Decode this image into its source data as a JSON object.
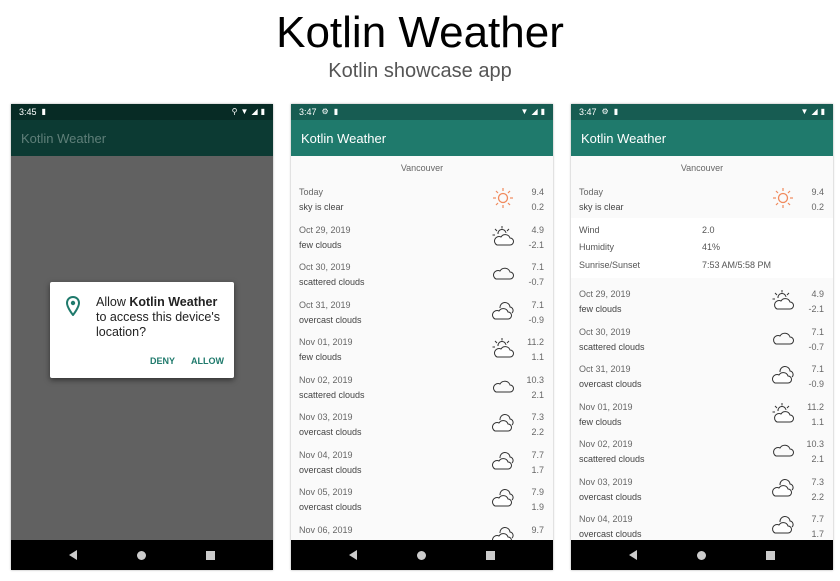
{
  "header": {
    "title": "Kotlin Weather",
    "subtitle": "Kotlin showcase app"
  },
  "colors": {
    "primary": "#1f7a6c",
    "primary_dark": "#175c52",
    "dim_status": "#072b25",
    "dim_appbar": "#0c3a33",
    "dim_body": "#616161"
  },
  "screens": [
    {
      "status_time": "3:45",
      "app_title": "Kotlin Weather",
      "dialog": {
        "text_prefix": "Allow ",
        "app_name": "Kotlin Weather",
        "text_suffix": " to access this device's location?",
        "deny": "DENY",
        "allow": "ALLOW"
      }
    },
    {
      "status_time": "3:47",
      "app_title": "Kotlin Weather",
      "city": "Vancouver",
      "rows": [
        {
          "date": "Today",
          "desc": "sky is clear",
          "max": "9.4",
          "min": "0.2",
          "icon": "sun-icon"
        },
        {
          "date": "Oct 29, 2019",
          "desc": "few clouds",
          "max": "4.9",
          "min": "-2.1",
          "icon": "sun-cloud-icon"
        },
        {
          "date": "Oct 30, 2019",
          "desc": "scattered clouds",
          "max": "7.1",
          "min": "-0.7",
          "icon": "cloud-icon"
        },
        {
          "date": "Oct 31, 2019",
          "desc": "overcast clouds",
          "max": "7.1",
          "min": "-0.9",
          "icon": "overcast-icon"
        },
        {
          "date": "Nov 01, 2019",
          "desc": "few clouds",
          "max": "11.2",
          "min": "1.1",
          "icon": "sun-cloud-icon"
        },
        {
          "date": "Nov 02, 2019",
          "desc": "scattered clouds",
          "max": "10.3",
          "min": "2.1",
          "icon": "cloud-icon"
        },
        {
          "date": "Nov 03, 2019",
          "desc": "overcast clouds",
          "max": "7.3",
          "min": "2.2",
          "icon": "overcast-icon"
        },
        {
          "date": "Nov 04, 2019",
          "desc": "overcast clouds",
          "max": "7.7",
          "min": "1.7",
          "icon": "overcast-icon"
        },
        {
          "date": "Nov 05, 2019",
          "desc": "overcast clouds",
          "max": "7.9",
          "min": "1.9",
          "icon": "overcast-icon"
        },
        {
          "date": "Nov 06, 2019",
          "desc": "",
          "max": "9.7",
          "min": "",
          "icon": "overcast-icon"
        }
      ]
    },
    {
      "status_time": "3:47",
      "app_title": "Kotlin Weather",
      "city": "Vancouver",
      "today": {
        "date": "Today",
        "desc": "sky is clear",
        "max": "9.4",
        "min": "0.2",
        "icon": "sun-icon"
      },
      "details": [
        {
          "label": "Wind",
          "value": "2.0"
        },
        {
          "label": "Humidity",
          "value": "41%"
        },
        {
          "label": "Sunrise/Sunset",
          "value": "7:53 AM/5:58 PM"
        }
      ],
      "rows": [
        {
          "date": "Oct 29, 2019",
          "desc": "few clouds",
          "max": "4.9",
          "min": "-2.1",
          "icon": "sun-cloud-icon"
        },
        {
          "date": "Oct 30, 2019",
          "desc": "scattered clouds",
          "max": "7.1",
          "min": "-0.7",
          "icon": "cloud-icon"
        },
        {
          "date": "Oct 31, 2019",
          "desc": "overcast clouds",
          "max": "7.1",
          "min": "-0.9",
          "icon": "overcast-icon"
        },
        {
          "date": "Nov 01, 2019",
          "desc": "few clouds",
          "max": "11.2",
          "min": "1.1",
          "icon": "sun-cloud-icon"
        },
        {
          "date": "Nov 02, 2019",
          "desc": "scattered clouds",
          "max": "10.3",
          "min": "2.1",
          "icon": "cloud-icon"
        },
        {
          "date": "Nov 03, 2019",
          "desc": "overcast clouds",
          "max": "7.3",
          "min": "2.2",
          "icon": "overcast-icon"
        },
        {
          "date": "Nov 04, 2019",
          "desc": "overcast clouds",
          "max": "7.7",
          "min": "1.7",
          "icon": "overcast-icon"
        }
      ]
    }
  ]
}
